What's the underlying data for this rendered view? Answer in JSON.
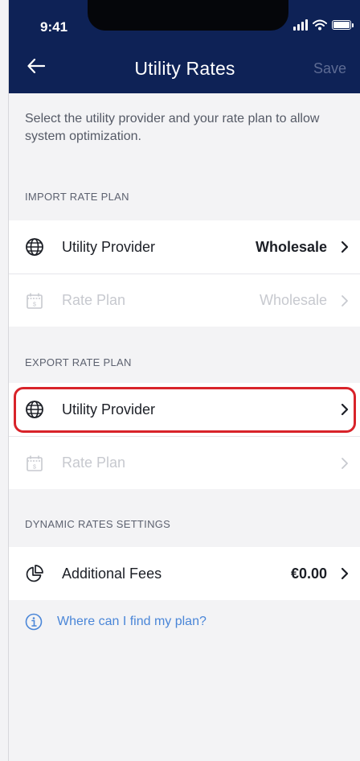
{
  "status_bar": {
    "time": "9:41"
  },
  "header": {
    "title": "Utility Rates",
    "save_label": "Save"
  },
  "intro_text": "Select the utility provider and your rate plan to allow system optimization.",
  "import_section": {
    "label": "IMPORT RATE PLAN",
    "provider": {
      "label": "Utility Provider",
      "value": "Wholesale"
    },
    "rate_plan": {
      "label": "Rate Plan",
      "value": "Wholesale"
    }
  },
  "export_section": {
    "label": "EXPORT RATE PLAN",
    "provider": {
      "label": "Utility Provider",
      "value": ""
    },
    "rate_plan": {
      "label": "Rate Plan",
      "value": ""
    }
  },
  "dynamic_section": {
    "label": "DYNAMIC RATES SETTINGS",
    "fees": {
      "label": "Additional Fees",
      "value": "€0.00"
    }
  },
  "help": {
    "label": "Where can I find my plan?"
  },
  "colors": {
    "header_bg": "#0e2256",
    "highlight": "#d8232a",
    "link": "#4a86d8"
  }
}
